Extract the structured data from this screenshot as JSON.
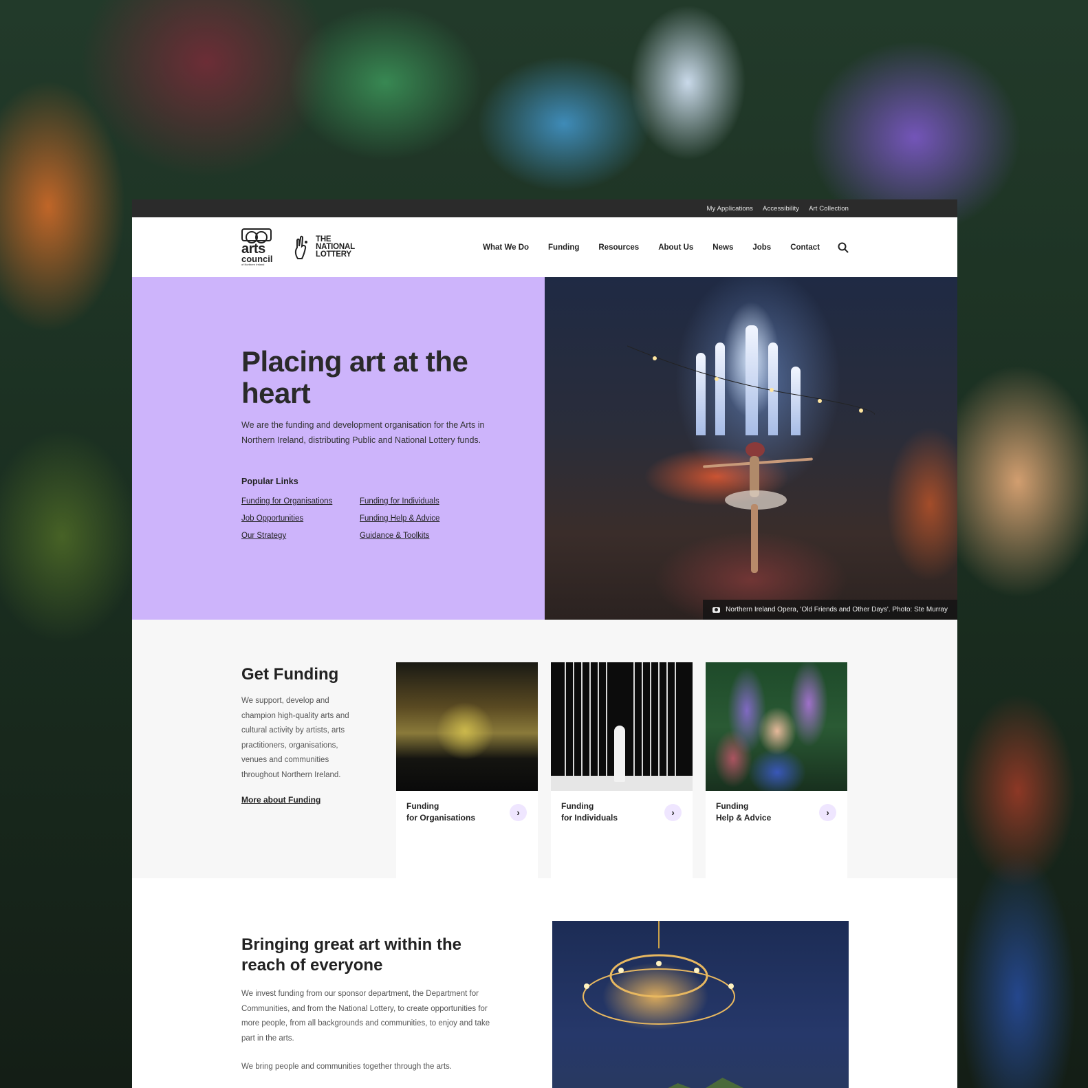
{
  "utility_nav": [
    "My Applications",
    "Accessibility",
    "Art Collection"
  ],
  "logos": {
    "arts_council": {
      "line1": "arts",
      "line2": "council",
      "line3": "of Northern Ireland"
    },
    "national_lottery": {
      "line1": "THE",
      "line2": "NATIONAL",
      "line3": "LOTTERY"
    }
  },
  "main_nav": [
    "What We Do",
    "Funding",
    "Resources",
    "About Us",
    "News",
    "Jobs",
    "Contact"
  ],
  "hero": {
    "title": "Placing art at the heart",
    "intro": "We are the funding and development organisation for the Arts in Northern Ireland, distributing Public and National Lottery funds.",
    "popular_title": "Popular Links",
    "popular_links": [
      "Funding for Organisations",
      "Funding for Individuals",
      "Job Opportunities",
      "Funding Help & Advice",
      "Our Strategy",
      "Guidance & Toolkits"
    ],
    "image_caption": "Northern Ireland Opera, 'Old Friends and Other Days'. Photo: Ste Murray"
  },
  "funding": {
    "title": "Get Funding",
    "text": "We support, develop and champion high-quality arts and cultural activity by artists, arts practitioners, organisations, venues and communities throughout Northern Ireland.",
    "link": "More about Funding",
    "cards": [
      {
        "line1": "Funding",
        "line2": "for Organisations"
      },
      {
        "line1": "Funding",
        "line2": "for Individuals"
      },
      {
        "line1": "Funding",
        "line2": "Help & Advice"
      }
    ],
    "card_arrow": "›"
  },
  "reach": {
    "title": "Bringing great art within the reach of everyone",
    "para1": "We invest funding from our sponsor department, the Department for Communities, and from the National Lottery, to create opportunities for more people, from all backgrounds and communities, to enjoy and take part in the arts.",
    "para2": "We bring people and communities together through the arts."
  },
  "colors": {
    "hero_bg": "#cdb4fb",
    "utility_bar": "#2b2b2b",
    "arrow_bg": "#efe6ff",
    "section_bg": "#f7f7f7"
  },
  "icons": [
    "search-icon",
    "camera-icon",
    "chevron-right-icon"
  ]
}
